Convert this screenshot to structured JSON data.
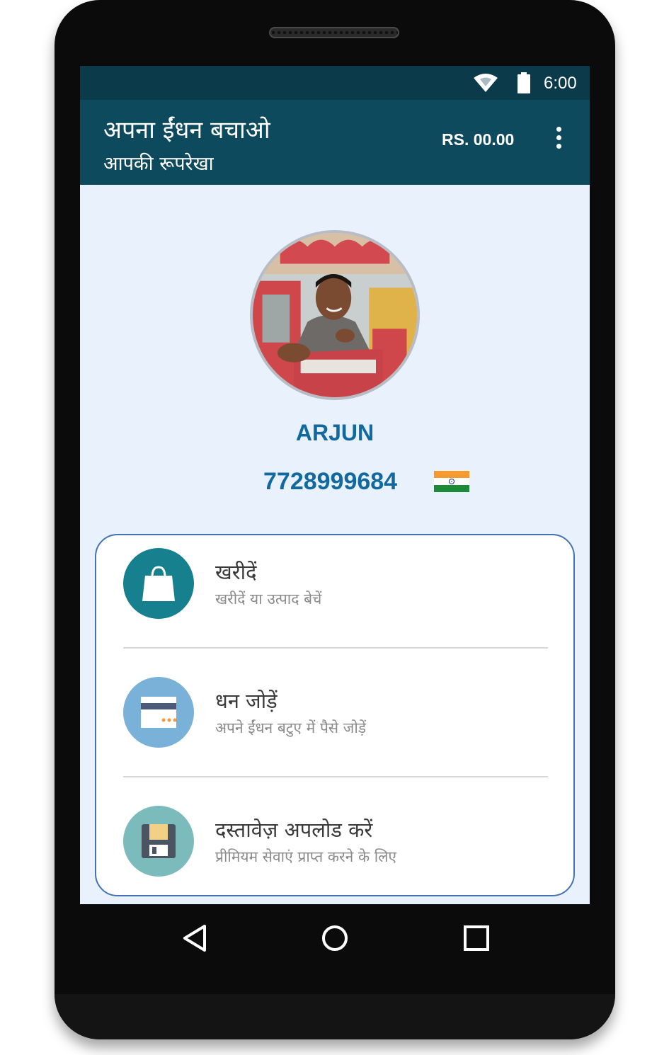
{
  "status_bar": {
    "time": "6:00",
    "icons": [
      "wifi-icon",
      "battery-icon"
    ]
  },
  "app_bar": {
    "title": "अपना ईंधन बचाओ",
    "subtitle": "आपकी रूपरेखा",
    "balance": "RS. 00.00",
    "menu_icon": "more-vert-icon"
  },
  "profile": {
    "name": "ARJUN",
    "phone": "7728999684",
    "flag": "india-flag-icon"
  },
  "options": [
    {
      "title": "खरीदें",
      "description": "खरीदें या उत्पाद बेचें",
      "icon": "shopping-bag-icon",
      "color": "#16808f"
    },
    {
      "title": "धन जोड़ें",
      "description": "अपने ईंधन बटुए में पैसे जोड़ें",
      "icon": "credit-card-icon",
      "color": "#79b1d9"
    },
    {
      "title": "दस्तावेज़ अपलोड करें",
      "description": "प्रीमियम सेवाएं प्राप्त करने के लिए",
      "icon": "floppy-disk-icon",
      "color": "#7cbbbb"
    }
  ],
  "nav_bar": {
    "buttons": [
      "back-icon",
      "home-icon",
      "recents-icon"
    ]
  },
  "colors": {
    "status_bar": "#0b3a4a",
    "app_bar": "#0e4a5e",
    "accent_text": "#11699f",
    "card_border": "#4473b4",
    "screen_bg": "#e9f1fd"
  }
}
